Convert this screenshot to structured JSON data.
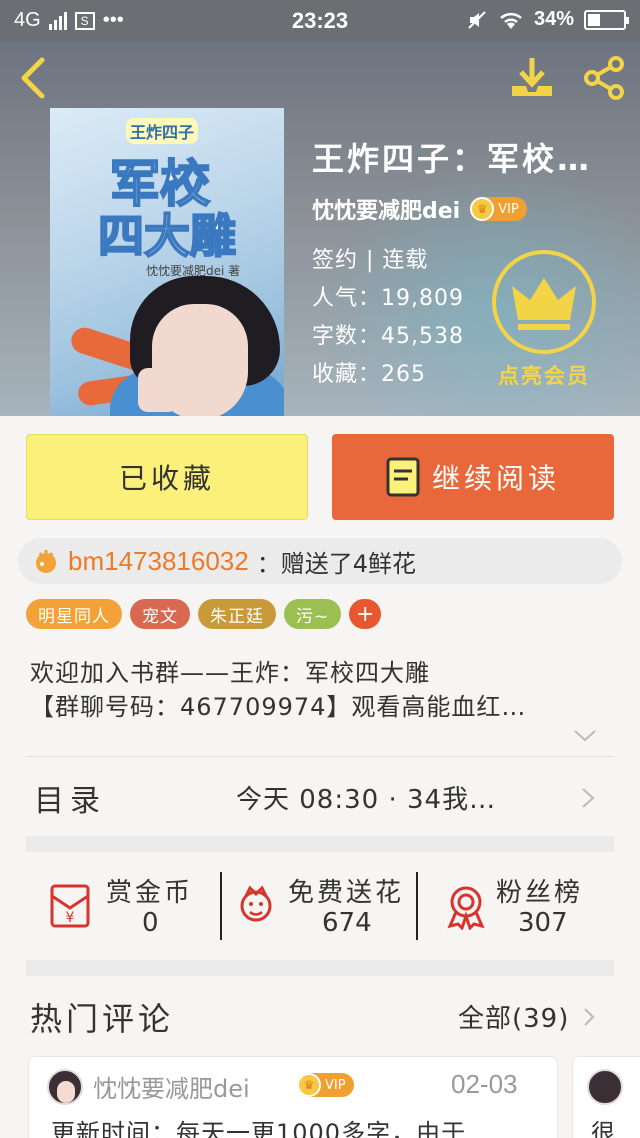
{
  "status_bar": {
    "network": "4G",
    "time": "23:23",
    "battery": "34%",
    "battery_level": 0.34
  },
  "book": {
    "title": "王炸四子：军校…",
    "author": "忱忱要减肥dei",
    "vip_badge": "VIP",
    "status": "签约 | 连载",
    "popularity": "人气：19,809",
    "words": "字数：45,538",
    "favorites": "收藏：265",
    "vip_cta": "点亮会员"
  },
  "cover": {
    "small_title": "王炸四子",
    "title_line1": "军校",
    "title_line2": "四大雕",
    "author_line": "忱忱要减肥dei 著"
  },
  "actions": {
    "favorited_label": "已收藏",
    "continue_label": "继续阅读"
  },
  "gift": {
    "user": "bm1473816032",
    "text": "：赠送了4鲜花"
  },
  "tags": [
    {
      "label": "明星同人",
      "color": "#f2a236"
    },
    {
      "label": "宠文",
      "color": "#d8684f"
    },
    {
      "label": "朱正廷",
      "color": "#c99a3a"
    },
    {
      "label": "污~",
      "color": "#9cbf52"
    }
  ],
  "tag_add": "+",
  "description": {
    "line1": "欢迎加入书群——王炸：军校四大雕",
    "line2": "【群聊号码：467709974】观看高能血红…"
  },
  "toc": {
    "label": "目录",
    "update": "今天 08:30 · 34我…"
  },
  "stats": [
    {
      "label": "赏金币",
      "value": "0",
      "icon": "red-envelope-icon"
    },
    {
      "label": "免费送花",
      "value": "674",
      "icon": "flower-icon"
    },
    {
      "label": "粉丝榜",
      "value": "307",
      "icon": "medal-icon"
    }
  ],
  "comments": {
    "title": "热门评论",
    "all_label": "全部(39)",
    "items": [
      {
        "user": "忱忱要减肥dei",
        "vip": "VIP",
        "date": "02-03",
        "text": "更新时间：每天一更1000多字，由于"
      },
      {
        "text": "很"
      }
    ]
  },
  "colors": {
    "accent_orange": "#e8683b",
    "fav_yellow": "#fbf07a",
    "gold": "#f4d447"
  }
}
